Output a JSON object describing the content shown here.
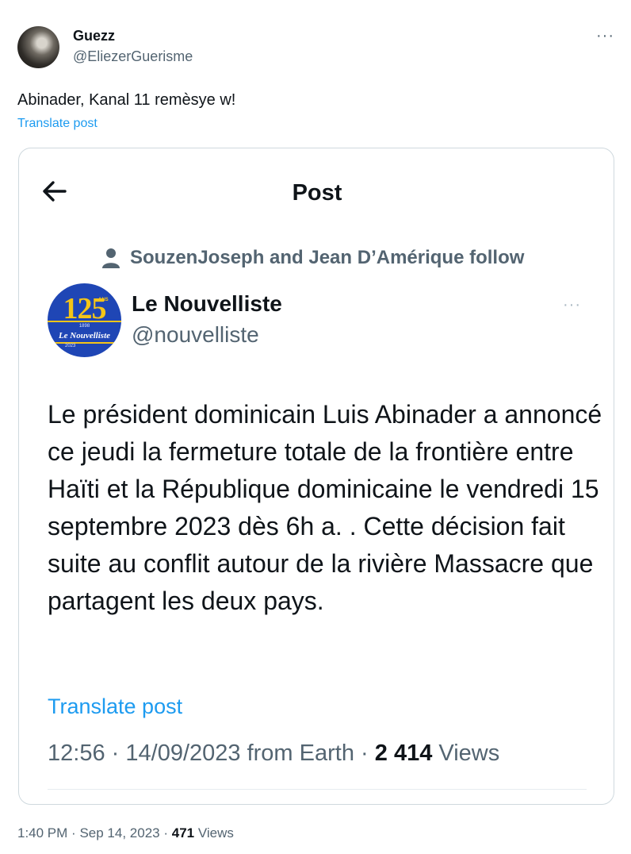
{
  "tweet": {
    "author_name": "Guezz",
    "author_handle": "@EliezerGuerisme",
    "more": "···",
    "text": "Abinader, Kanal 11 remèsye w!",
    "translate": "Translate post",
    "time": "1:40 PM",
    "date": "Sep 14, 2023",
    "views_count": "471",
    "views_label": "Views",
    "separator": "·"
  },
  "embedded": {
    "header_title": "Post",
    "social_context": "SouzenJoseph and Jean D’Amérique follow",
    "author_name": "Le Nouvelliste",
    "author_handle": "@nouvelliste",
    "more": "···",
    "logo": {
      "number": "125",
      "years_label": "ANS",
      "year_start": "1898",
      "brand": "Le Nouvelliste",
      "year_end": "2023"
    },
    "text": "Le président dominicain Luis Abinader a annoncé ce jeudi la fermeture totale de la frontière entre Haïti et la République dominicaine le vendredi 15 septembre 2023 dès 6h a. . Cette décision fait suite au conflit autour de la rivière Massacre que partagent les deux pays.",
    "translate": "Translate post",
    "time": "12:56",
    "date": "14/09/2023",
    "source": "from Earth",
    "views_count": "2 414",
    "views_label": "Views",
    "separator": "·"
  },
  "colors": {
    "text_primary": "#0f1419",
    "text_secondary": "#536471",
    "link_blue": "#1d9bf0",
    "border": "#cfd9de",
    "logo_blue": "#1f46b5",
    "logo_gold": "#f5c518"
  }
}
